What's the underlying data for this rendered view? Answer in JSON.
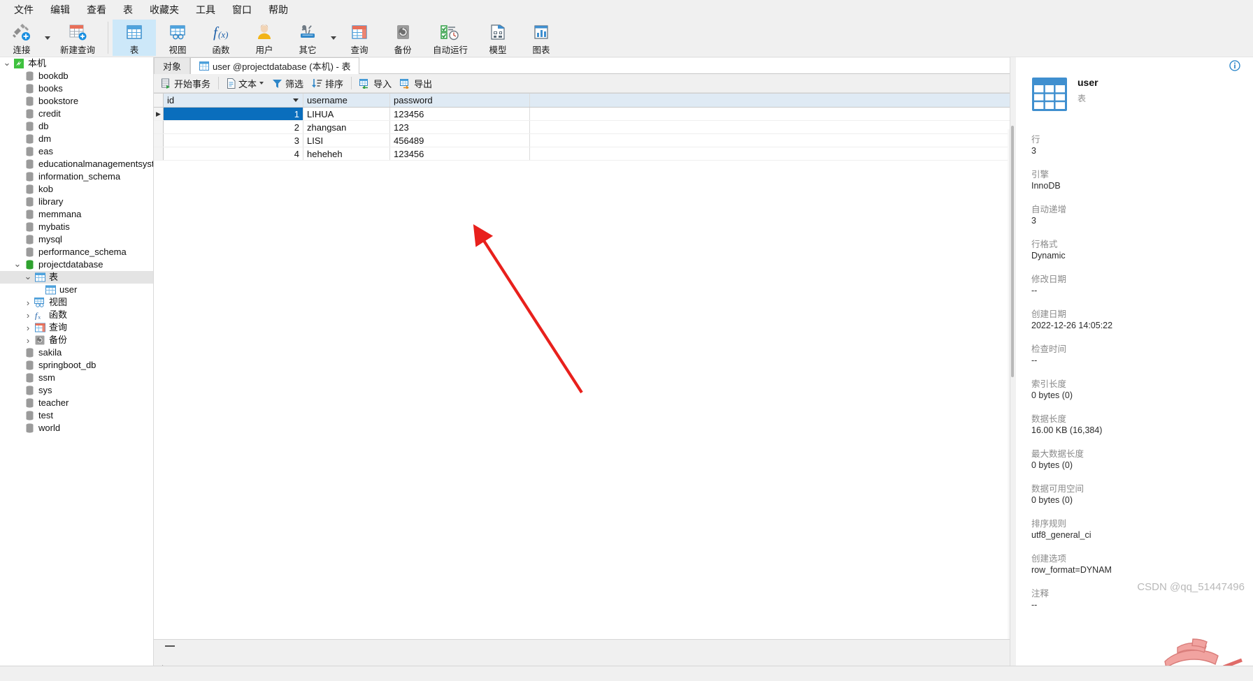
{
  "menubar": {
    "items": [
      {
        "label": "文件"
      },
      {
        "label": "编辑"
      },
      {
        "label": "查看"
      },
      {
        "label": "表"
      },
      {
        "label": "收藏夹"
      },
      {
        "label": "工具"
      },
      {
        "label": "窗口"
      },
      {
        "label": "帮助"
      }
    ]
  },
  "toolbar": {
    "items": [
      {
        "label": "连接",
        "icon": "connect-icon",
        "active": false,
        "caret": true
      },
      {
        "label": "新建查询",
        "icon": "new-query-icon",
        "active": false,
        "caret": false
      },
      {
        "label": "表",
        "icon": "table-icon",
        "active": true,
        "caret": false
      },
      {
        "label": "视图",
        "icon": "view-icon",
        "active": false,
        "caret": false
      },
      {
        "label": "函数",
        "icon": "function-icon",
        "active": false,
        "caret": false
      },
      {
        "label": "用户",
        "icon": "user-icon",
        "active": false,
        "caret": false
      },
      {
        "label": "其它",
        "icon": "other-tools-icon",
        "active": false,
        "caret": true
      },
      {
        "label": "查询",
        "icon": "query-icon",
        "active": false,
        "caret": false
      },
      {
        "label": "备份",
        "icon": "backup-icon",
        "active": false,
        "caret": false
      },
      {
        "label": "自动运行",
        "icon": "automation-icon",
        "active": false,
        "caret": false
      },
      {
        "label": "模型",
        "icon": "model-icon",
        "active": false,
        "caret": false
      },
      {
        "label": "图表",
        "icon": "chart-icon",
        "active": false,
        "caret": false
      }
    ]
  },
  "sidebar": {
    "nodes": [
      {
        "label": "本机",
        "icon": "connection-icon",
        "depth": 0,
        "chevron": "down",
        "selected": false
      },
      {
        "label": "bookdb",
        "icon": "database-icon",
        "depth": 1,
        "chevron": "",
        "selected": false
      },
      {
        "label": "books",
        "icon": "database-icon",
        "depth": 1,
        "chevron": "",
        "selected": false
      },
      {
        "label": "bookstore",
        "icon": "database-icon",
        "depth": 1,
        "chevron": "",
        "selected": false
      },
      {
        "label": "credit",
        "icon": "database-icon",
        "depth": 1,
        "chevron": "",
        "selected": false
      },
      {
        "label": "db",
        "icon": "database-icon",
        "depth": 1,
        "chevron": "",
        "selected": false
      },
      {
        "label": "dm",
        "icon": "database-icon",
        "depth": 1,
        "chevron": "",
        "selected": false
      },
      {
        "label": "eas",
        "icon": "database-icon",
        "depth": 1,
        "chevron": "",
        "selected": false
      },
      {
        "label": "educationalmanagementsystem",
        "icon": "database-icon",
        "depth": 1,
        "chevron": "",
        "selected": false
      },
      {
        "label": "information_schema",
        "icon": "database-icon",
        "depth": 1,
        "chevron": "",
        "selected": false
      },
      {
        "label": "kob",
        "icon": "database-icon",
        "depth": 1,
        "chevron": "",
        "selected": false
      },
      {
        "label": "library",
        "icon": "database-icon",
        "depth": 1,
        "chevron": "",
        "selected": false
      },
      {
        "label": "memmana",
        "icon": "database-icon",
        "depth": 1,
        "chevron": "",
        "selected": false
      },
      {
        "label": "mybatis",
        "icon": "database-icon",
        "depth": 1,
        "chevron": "",
        "selected": false
      },
      {
        "label": "mysql",
        "icon": "database-icon",
        "depth": 1,
        "chevron": "",
        "selected": false
      },
      {
        "label": "performance_schema",
        "icon": "database-icon",
        "depth": 1,
        "chevron": "",
        "selected": false
      },
      {
        "label": "projectdatabase",
        "icon": "database-open-icon",
        "depth": 1,
        "chevron": "down",
        "selected": false
      },
      {
        "label": "表",
        "icon": "table-icon",
        "depth": 2,
        "chevron": "down",
        "selected": true
      },
      {
        "label": "user",
        "icon": "table-icon",
        "depth": 3,
        "chevron": "",
        "selected": false
      },
      {
        "label": "视图",
        "icon": "view-icon",
        "depth": 2,
        "chevron": "right",
        "selected": false
      },
      {
        "label": "函数",
        "icon": "function-icon",
        "depth": 2,
        "chevron": "right",
        "selected": false
      },
      {
        "label": "查询",
        "icon": "query-icon",
        "depth": 2,
        "chevron": "right",
        "selected": false
      },
      {
        "label": "备份",
        "icon": "backup-icon",
        "depth": 2,
        "chevron": "right",
        "selected": false
      },
      {
        "label": "sakila",
        "icon": "database-icon",
        "depth": 1,
        "chevron": "",
        "selected": false
      },
      {
        "label": "springboot_db",
        "icon": "database-icon",
        "depth": 1,
        "chevron": "",
        "selected": false
      },
      {
        "label": "ssm",
        "icon": "database-icon",
        "depth": 1,
        "chevron": "",
        "selected": false
      },
      {
        "label": "sys",
        "icon": "database-icon",
        "depth": 1,
        "chevron": "",
        "selected": false
      },
      {
        "label": "teacher",
        "icon": "database-icon",
        "depth": 1,
        "chevron": "",
        "selected": false
      },
      {
        "label": "test",
        "icon": "database-icon",
        "depth": 1,
        "chevron": "",
        "selected": false
      },
      {
        "label": "world",
        "icon": "database-icon",
        "depth": 1,
        "chevron": "",
        "selected": false
      }
    ]
  },
  "tabs": [
    {
      "label": "对象",
      "icon": "",
      "active": false
    },
    {
      "label": "user @projectdatabase (本机) - 表",
      "icon": "table-icon",
      "active": true
    }
  ],
  "gridtoolbar": {
    "buttons": [
      {
        "label": "开始事务",
        "icon": "transaction-icon",
        "caret": false
      },
      {
        "label": "文本",
        "icon": "text-icon",
        "caret": true
      },
      {
        "label": "筛选",
        "icon": "filter-icon",
        "caret": false
      },
      {
        "label": "排序",
        "icon": "sort-icon",
        "caret": false
      },
      {
        "label": "导入",
        "icon": "import-icon",
        "caret": false
      },
      {
        "label": "导出",
        "icon": "export-icon",
        "caret": false
      }
    ]
  },
  "grid": {
    "columns": [
      "id",
      "username",
      "password"
    ],
    "sorted_column": "id",
    "rows": [
      {
        "id": "1",
        "username": "LIHUA",
        "password": "123456",
        "selected": true
      },
      {
        "id": "2",
        "username": "zhangsan",
        "password": "123",
        "selected": false
      },
      {
        "id": "3",
        "username": "LISI",
        "password": "456489",
        "selected": false
      },
      {
        "id": "4",
        "username": "heheheh",
        "password": "123456",
        "selected": false
      }
    ]
  },
  "infopanel": {
    "object_name": "user",
    "object_kind": "表",
    "info_icon": "info-circle-icon",
    "properties": [
      {
        "label": "行",
        "value": "3"
      },
      {
        "label": "引擎",
        "value": "InnoDB"
      },
      {
        "label": "自动递增",
        "value": "3"
      },
      {
        "label": "行格式",
        "value": "Dynamic"
      },
      {
        "label": "修改日期",
        "value": "--"
      },
      {
        "label": "创建日期",
        "value": "2022-12-26 14:05:22"
      },
      {
        "label": "检查时间",
        "value": "--"
      },
      {
        "label": "索引长度",
        "value": "0 bytes (0)"
      },
      {
        "label": "数据长度",
        "value": "16.00 KB (16,384)"
      },
      {
        "label": "最大数据长度",
        "value": "0 bytes (0)"
      },
      {
        "label": "数据可用空间",
        "value": "0 bytes (0)"
      },
      {
        "label": "排序规则",
        "value": "utf8_general_ci"
      },
      {
        "label": "创建选项",
        "value": "row_format=DYNAM"
      },
      {
        "label": "注释",
        "value": "--"
      }
    ]
  },
  "watermark": {
    "text": "CSDN @qq_51447496"
  },
  "colors": {
    "accent_blue": "#0a6ebd",
    "toolbar_active": "#cde8f9",
    "header_blue": "#dfeaf4",
    "arrow_red": "#e8201c"
  }
}
